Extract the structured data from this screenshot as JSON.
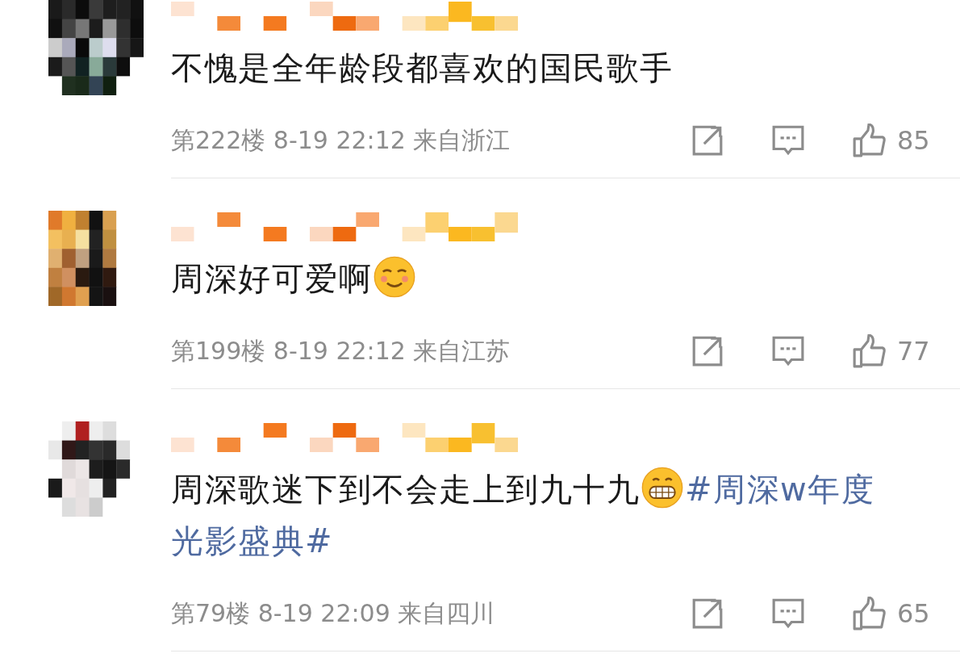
{
  "comments": [
    {
      "content": [
        {
          "kind": "text",
          "text": "不愧是全年龄段都喜欢的国民歌手"
        }
      ],
      "meta": "第222楼 8-19 22:12 来自浙江",
      "likes": "85"
    },
    {
      "content": [
        {
          "kind": "text",
          "text": "周深好可爱啊"
        },
        {
          "kind": "smile-emoji"
        }
      ],
      "meta": "第199楼 8-19 22:12 来自江苏",
      "likes": "77"
    },
    {
      "content": [
        {
          "kind": "text",
          "text": "周深歌迷下到不会走上到九十九"
        },
        {
          "kind": "grin-emoji"
        },
        {
          "kind": "hashtag",
          "text": "#周深w年度"
        },
        {
          "kind": "hashtag",
          "text": "光影盛典#"
        }
      ],
      "meta": "第79楼 8-19 22:09 来自四川",
      "likes": "65"
    }
  ]
}
